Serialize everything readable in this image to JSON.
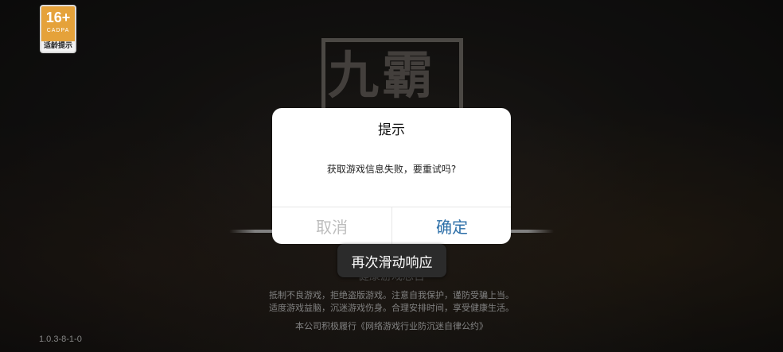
{
  "age_badge": {
    "rating": "16+",
    "org": "CADPA",
    "caption": "适龄提示"
  },
  "logo": {
    "text": "九霸"
  },
  "dialog": {
    "title": "提示",
    "message": "获取游戏信息失败，要重试吗?",
    "cancel_label": "取消",
    "confirm_label": "确定"
  },
  "toast": {
    "text": "再次滑动响应"
  },
  "notice": {
    "title": "健康游戏忠告",
    "line1": "抵制不良游戏，拒绝盗版游戏。注意自我保护，谨防受骗上当。",
    "line2": "适度游戏益脑，沉迷游戏伤身。合理安排时间，享受健康生活。",
    "line3": "本公司积极履行《网络游戏行业防沉迷自律公约》"
  },
  "version": "1.0.3-8-1-0",
  "colors": {
    "confirm": "#2d6fa8",
    "cancel_disabled": "#bdbdbd",
    "badge": "#e5a23a"
  }
}
